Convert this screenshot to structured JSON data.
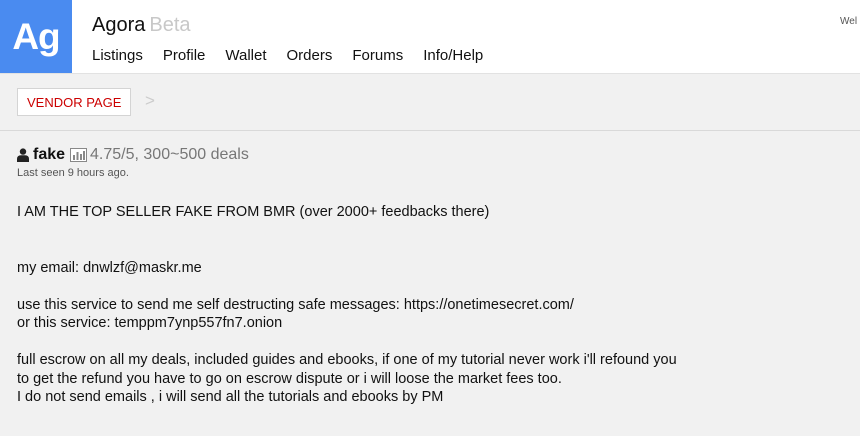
{
  "header": {
    "logo": "Ag",
    "brand": "Agora",
    "beta": "Beta",
    "welcome": "Wel",
    "nav": [
      "Listings",
      "Profile",
      "Wallet",
      "Orders",
      "Forums",
      "Info/Help"
    ]
  },
  "breadcrumb": {
    "vendor_page": "VENDOR PAGE",
    "separator": ">"
  },
  "seller": {
    "name": "fake",
    "rating": "4.75/5, 300~500 deals",
    "last_seen": "Last seen 9 hours ago."
  },
  "description": {
    "line1": "I AM THE TOP SELLER FAKE FROM BMR (over 2000+ feedbacks there)",
    "line2": "my email: dnwlzf@maskr.me",
    "line3": "use this service to send me self destructing safe messages: https://onetimesecret.com/",
    "line4": "or this service: temppm7ynp557fn7.onion",
    "line5": "full escrow on all my deals, included guides and ebooks, if one of my tutorial never work i'll refound you",
    "line6": "to get the refund you have to go on escrow dispute or i will loose the market fees too.",
    "line7": "I do not send emails , i will send all the tutorials and ebooks by PM"
  },
  "colors": {
    "logo_bg": "#4a8bf0",
    "vendor_text": "#cc0000",
    "page_bg": "#f1f1f1"
  }
}
